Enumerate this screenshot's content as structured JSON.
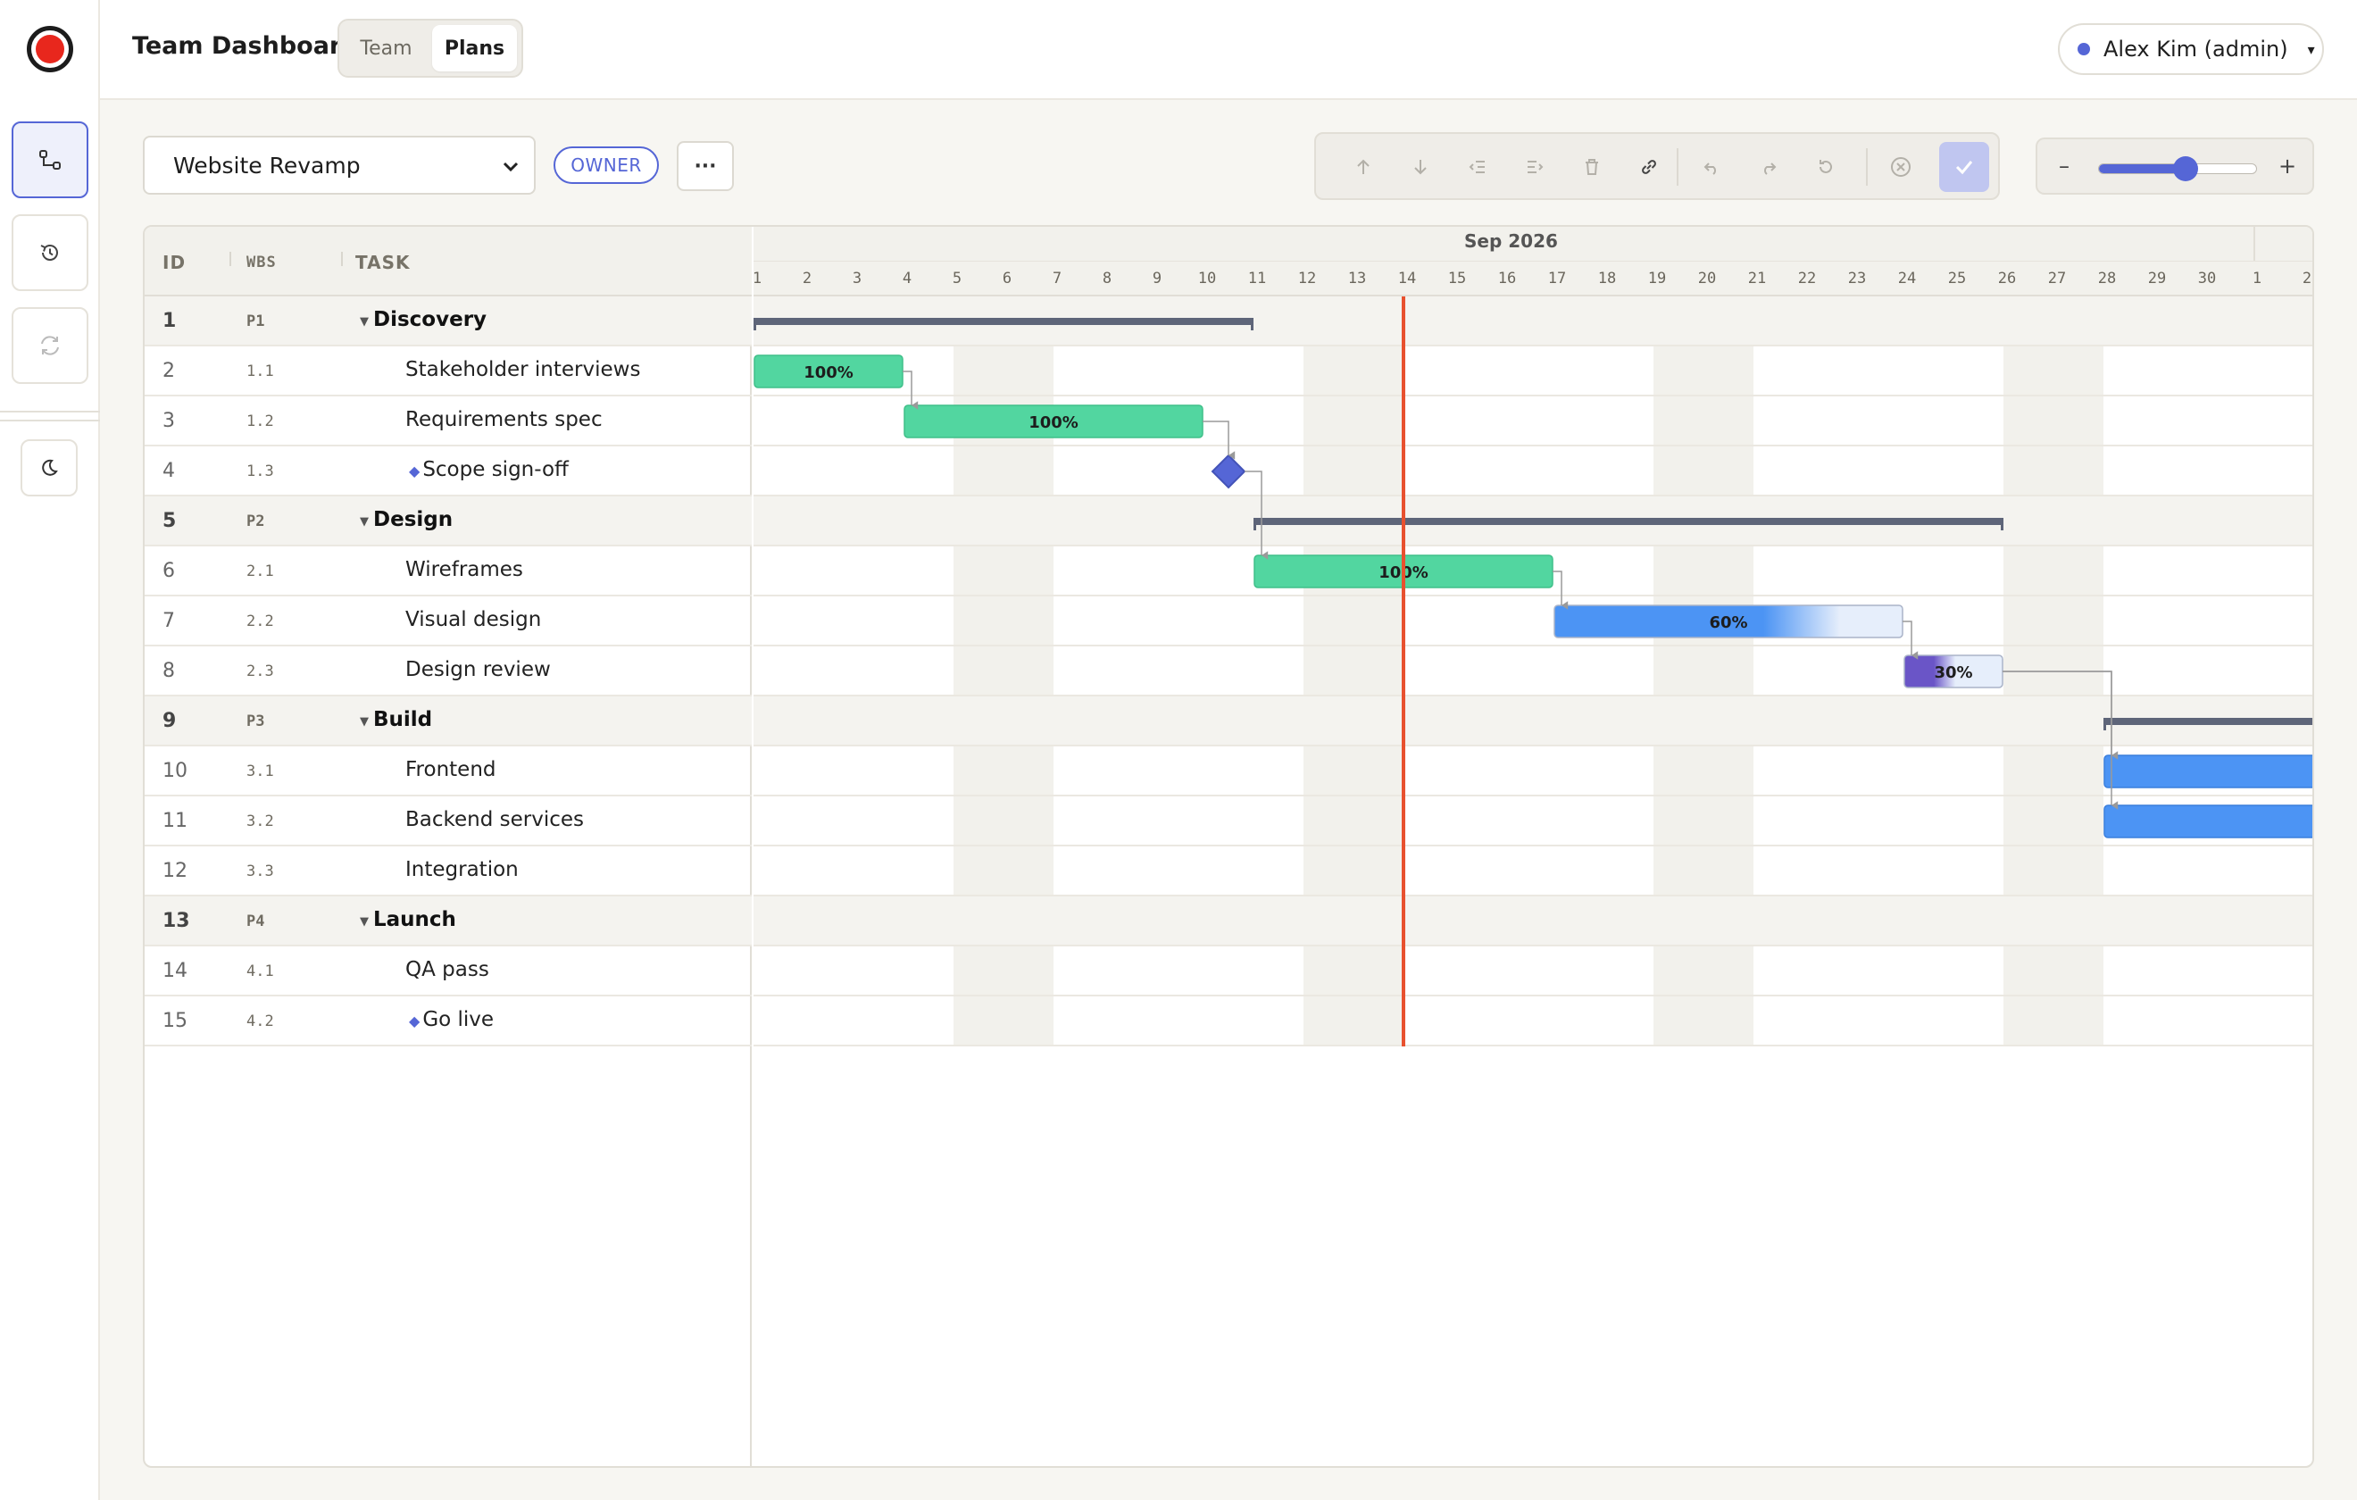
{
  "header": {
    "app_title": "Team Dashboard",
    "tabs": [
      {
        "label": "Team",
        "active": false
      },
      {
        "label": "Plans",
        "active": true
      }
    ],
    "user": "Alex Kim (admin)",
    "user_caret": "▾"
  },
  "toolbar": {
    "plan_select": "Website Revamp",
    "role_badge": "OWNER",
    "more_label": "···",
    "zoom_minus": "–",
    "zoom_plus": "+",
    "zoom_level": 0.55
  },
  "grid": {
    "columns": {
      "id": "ID",
      "wbs": "WBS",
      "task": "TASK"
    },
    "rows": [
      {
        "id": "1",
        "wbs": "P1",
        "task": "Discovery",
        "group": true
      },
      {
        "id": "2",
        "wbs": "1.1",
        "task": "Stakeholder interviews"
      },
      {
        "id": "3",
        "wbs": "1.2",
        "task": "Requirements spec"
      },
      {
        "id": "4",
        "wbs": "1.3",
        "task": "Scope sign-off",
        "milestone": true
      },
      {
        "id": "5",
        "wbs": "P2",
        "task": "Design",
        "group": true
      },
      {
        "id": "6",
        "wbs": "2.1",
        "task": "Wireframes"
      },
      {
        "id": "7",
        "wbs": "2.2",
        "task": "Visual design"
      },
      {
        "id": "8",
        "wbs": "2.3",
        "task": "Design review"
      },
      {
        "id": "9",
        "wbs": "P3",
        "task": "Build",
        "group": true
      },
      {
        "id": "10",
        "wbs": "3.1",
        "task": "Frontend"
      },
      {
        "id": "11",
        "wbs": "3.2",
        "task": "Backend services"
      },
      {
        "id": "12",
        "wbs": "3.3",
        "task": "Integration"
      },
      {
        "id": "13",
        "wbs": "P4",
        "task": "Launch",
        "group": true
      },
      {
        "id": "14",
        "wbs": "4.1",
        "task": "QA pass"
      },
      {
        "id": "15",
        "wbs": "4.2",
        "task": "Go live",
        "milestone": true
      }
    ]
  },
  "timeline": {
    "month": "Sep 2026",
    "days": [
      "1",
      "2",
      "3",
      "4",
      "5",
      "6",
      "7",
      "8",
      "9",
      "10",
      "11",
      "12",
      "13",
      "14",
      "15",
      "16",
      "17",
      "18",
      "19",
      "20",
      "21",
      "22",
      "23",
      "24",
      "25",
      "26",
      "27",
      "28",
      "29",
      "30",
      "1",
      "2"
    ],
    "weekend_start_days": [
      5,
      12,
      19,
      26
    ],
    "today_day": 14,
    "colors": {
      "done": "#52d6a0",
      "progress": "#4c94f4",
      "review": "#6a55c7",
      "summary": "#5e6579",
      "milestone": "#5566d6",
      "today": "#e8512f",
      "link": "#9a9a9a"
    },
    "bars": [
      {
        "row": 0,
        "type": "summary",
        "start": 1,
        "end": 11
      },
      {
        "row": 1,
        "type": "task",
        "start": 1,
        "end": 4,
        "progress": 100,
        "label": "100%"
      },
      {
        "row": 2,
        "type": "task",
        "start": 4,
        "end": 10,
        "progress": 100,
        "label": "100%"
      },
      {
        "row": 3,
        "type": "milestone",
        "at": 10.5
      },
      {
        "row": 4,
        "type": "summary",
        "start": 11,
        "end": 26
      },
      {
        "row": 5,
        "type": "task",
        "start": 11,
        "end": 17,
        "progress": 100,
        "label": "100%"
      },
      {
        "row": 6,
        "type": "task",
        "start": 17,
        "end": 24,
        "progress": 60,
        "label": "60%"
      },
      {
        "row": 7,
        "type": "task",
        "start": 24,
        "end": 26,
        "progress": 30,
        "label": "30%"
      },
      {
        "row": 8,
        "type": "summary",
        "start": 28,
        "end": 34
      },
      {
        "row": 9,
        "type": "task",
        "start": 28,
        "end": 34,
        "progress": 0
      },
      {
        "row": 10,
        "type": "task",
        "start": 28,
        "end": 34,
        "progress": 0
      }
    ],
    "links": [
      {
        "from": 1,
        "to": 2
      },
      {
        "from": 2,
        "to": 3
      },
      {
        "from": 3,
        "to": 5
      },
      {
        "from": 5,
        "to": 6
      },
      {
        "from": 6,
        "to": 7
      },
      {
        "from": 7,
        "to": 9
      },
      {
        "from": 7,
        "to": 10
      }
    ]
  }
}
